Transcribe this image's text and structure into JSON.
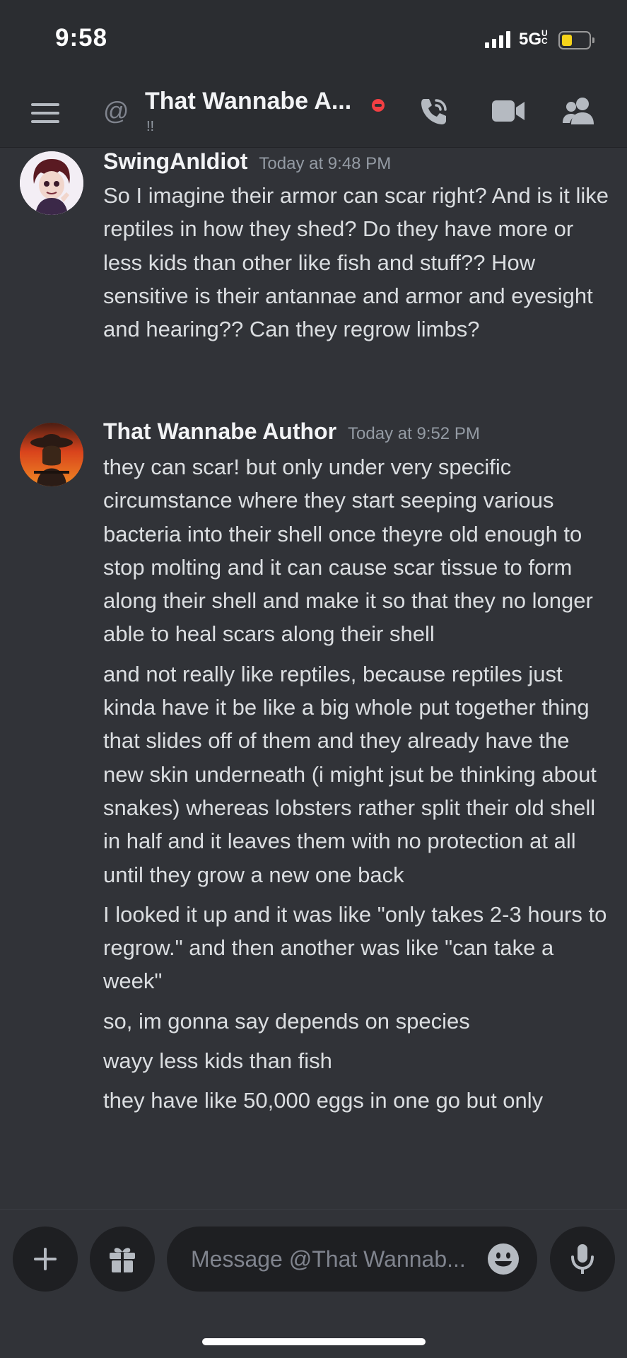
{
  "status_bar": {
    "time": "9:58",
    "network": "5G",
    "network_suffix": "UC",
    "battery_level": 0.45
  },
  "header": {
    "prefix_icon": "at-icon",
    "title": "That Wannabe A...",
    "status": "do-not-disturb",
    "subtitle": "!!",
    "actions": [
      "voice-call-icon",
      "video-call-icon",
      "members-icon"
    ]
  },
  "messages": [
    {
      "author": "SwingAnIdiot",
      "timestamp": "Today at 9:48 PM",
      "paragraphs": [
        "So I imagine their armor can scar right? And is it like reptiles in how they shed? Do they have more or less kids than other like fish and stuff?? How sensitive is their antannae and armor and eyesight and hearing?? Can they regrow limbs?"
      ]
    },
    {
      "author": "That Wannabe Author",
      "timestamp": "Today at 9:52 PM",
      "paragraphs": [
        "they can scar! but only under very specific circumstance where they start seeping various bacteria into their shell once theyre old enough to stop molting and it can cause scar tissue to form along their shell and make it so that they no longer able to heal scars along their shell",
        "and not really like reptiles, because reptiles just kinda have it be like a big whole put together thing that slides off of them and they already have the new skin underneath (i might jsut be thinking about snakes) whereas lobsters rather split their old shell in half and it leaves them with no protection at all until they grow a new one back",
        "I looked it up and it was like \"only takes 2-3 hours to regrow.\" and then another was like \"can take a week\"",
        "so, im gonna say depends on species",
        "wayy less kids than fish",
        "they have like 50,000 eggs in one go but only"
      ]
    }
  ],
  "composer": {
    "placeholder": "Message @That Wannab...",
    "buttons": [
      "plus-icon",
      "gift-icon",
      "emoji-icon",
      "microphone-icon"
    ]
  },
  "colors": {
    "background": "#313338",
    "header": "#2b2d31",
    "input": "#1e1f22",
    "dnd": "#f23f43",
    "battery": "#f5d31a"
  }
}
